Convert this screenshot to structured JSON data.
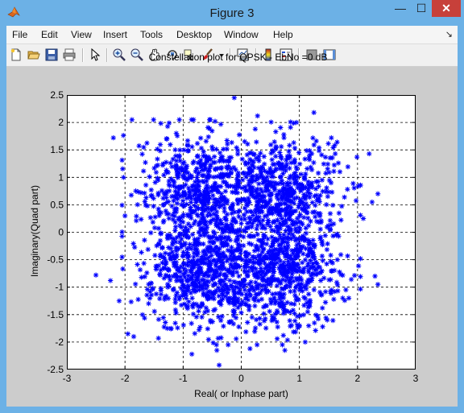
{
  "window": {
    "title": "Figure 3",
    "minimize_label": "—",
    "maximize_label": "☐",
    "close_label": "✕"
  },
  "menubar": {
    "items": [
      "File",
      "Edit",
      "View",
      "Insert",
      "Tools",
      "Desktop",
      "Window",
      "Help"
    ],
    "dock_label": "↘"
  },
  "toolbar": {
    "icons": [
      "new-figure-icon",
      "open-file-icon",
      "save-icon",
      "print-icon",
      "pointer-icon",
      "zoom-in-icon",
      "zoom-out-icon",
      "pan-icon",
      "rotate-3d-icon",
      "data-cursor-icon",
      "brush-icon",
      "brush-dropdown-icon",
      "link-plot-icon",
      "colorbar-icon",
      "legend-icon",
      "hide-plot-tools-icon",
      "show-plot-tools-icon"
    ]
  },
  "chart_data": {
    "type": "scatter",
    "title": "Constellation plot for QPSK - EbNo =0 dB",
    "xlabel": "Real( or Inphase part)",
    "ylabel": "Imaginary(Quad part)",
    "xlim": [
      -3,
      3
    ],
    "ylim": [
      -2.5,
      2.5
    ],
    "xticks": [
      "-3",
      "-2",
      "-1",
      "0",
      "1",
      "2",
      "3"
    ],
    "yticks": [
      "2.5",
      "2",
      "1.5",
      "1",
      "0.5",
      "0",
      "-0.5",
      "-1",
      "-1.5",
      "-2",
      "-2.5"
    ],
    "grid": true,
    "marker": "*",
    "marker_color": "#0000ff",
    "noise_sigma": 0.5,
    "cluster_centers": [
      [
        -0.7071,
        0.7071
      ],
      [
        0.7071,
        0.7071
      ],
      [
        -0.7071,
        -0.7071
      ],
      [
        0.7071,
        -0.7071
      ]
    ],
    "points_per_cluster": 600,
    "outliers": [
      [
        -0.12,
        2.45
      ],
      [
        0.28,
        2.12
      ],
      [
        -0.45,
        2.02
      ],
      [
        1.25,
        2.18
      ],
      [
        0.95,
        2.0
      ],
      [
        -2.2,
        1.72
      ],
      [
        1.55,
        1.72
      ],
      [
        2.2,
        1.43
      ],
      [
        2.35,
        0.7
      ],
      [
        2.25,
        0.55
      ],
      [
        -2.0,
        0.3
      ],
      [
        -2.5,
        -0.78
      ],
      [
        -2.25,
        -0.88
      ],
      [
        -2.1,
        -1.25
      ],
      [
        2.3,
        -0.8
      ],
      [
        2.35,
        -0.95
      ],
      [
        1.85,
        -1.2
      ],
      [
        -1.85,
        -1.9
      ],
      [
        -0.85,
        -2.22
      ],
      [
        -0.42,
        -2.15
      ],
      [
        -0.38,
        -2.42
      ],
      [
        0.15,
        -2.12
      ],
      [
        0.75,
        -2.15
      ],
      [
        1.1,
        -2.0
      ],
      [
        1.4,
        -1.72
      ],
      [
        -1.95,
        -1.85
      ],
      [
        2.1,
        0.25
      ]
    ]
  }
}
